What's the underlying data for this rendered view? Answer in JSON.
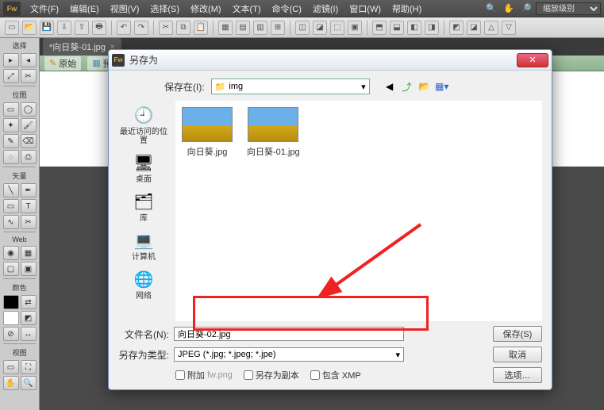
{
  "app": {
    "logo": "Fw"
  },
  "menu": {
    "file": "文件(F)",
    "edit": "编辑(E)",
    "view": "视图(V)",
    "select": "选择(S)",
    "modify": "修改(M)",
    "text": "文本(T)",
    "commands": "命令(C)",
    "filters": "滤镜(I)",
    "window": "窗口(W)",
    "help": "帮助(H)",
    "workspace_dropdown": "缩放级别"
  },
  "tab": {
    "title": "*向日葵-01.jpg"
  },
  "subbar": {
    "original": "原始",
    "preview": "预览"
  },
  "toolpanel": {
    "select": "选择",
    "bitmap": "位图",
    "vector": "矢量",
    "web": "Web",
    "color": "颜色",
    "view": "视图"
  },
  "dialog": {
    "title": "另存为",
    "save_in_label": "保存在(I):",
    "folder": "img",
    "places": {
      "recent": "最近访问的位置",
      "desktop": "桌面",
      "libraries": "库",
      "computer": "计算机",
      "network": "网络"
    },
    "files": {
      "f1": "向日葵.jpg",
      "f2": "向日葵-01.jpg"
    },
    "filename_label": "文件名(N):",
    "filename_value": "向日葵-02.jpg",
    "filetype_label": "另存为类型:",
    "filetype_value": "JPEG (*.jpg; *.jpeg; *.jpe)",
    "save_btn": "保存(S)",
    "cancel_btn": "取消",
    "options_btn": "选项…",
    "attach_label": "附加",
    "attach_file": "fw.png",
    "save_copy_label": "另存为副本",
    "include_xmp_label": "包含 XMP"
  }
}
